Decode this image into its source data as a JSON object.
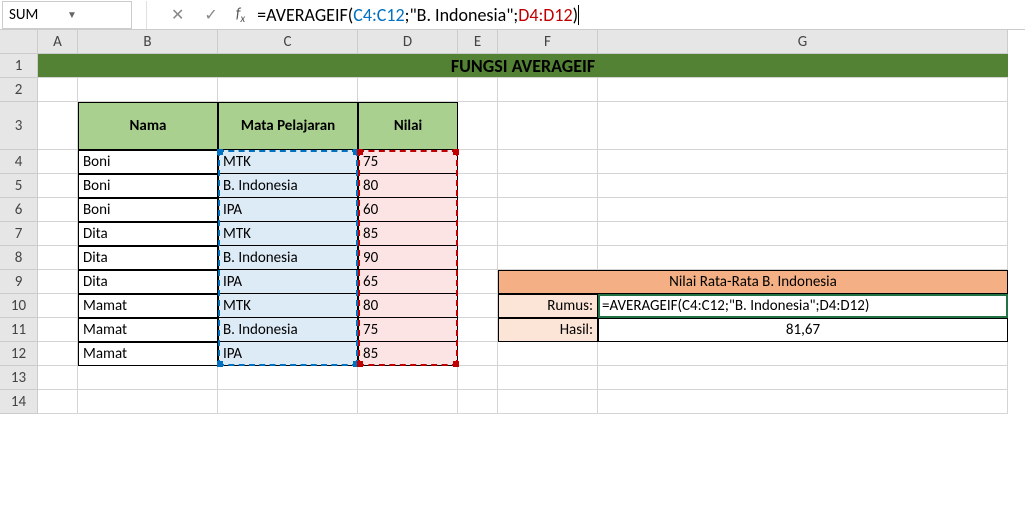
{
  "nameBox": "SUM",
  "formulaBar": {
    "prefix": "=AVERAGEIF(",
    "ref1": "C4:C12",
    "mid1": ";\"B. Indonesia\";",
    "ref2": "D4:D12",
    "suffix": ")"
  },
  "columns": [
    "A",
    "B",
    "C",
    "D",
    "E",
    "F",
    "G"
  ],
  "rows": [
    "1",
    "2",
    "3",
    "4",
    "5",
    "6",
    "7",
    "8",
    "9",
    "10",
    "11",
    "12",
    "13",
    "14"
  ],
  "title": "FUNGSI AVERAGEIF",
  "headers": {
    "nama": "Nama",
    "mapel": "Mata Pelajaran",
    "nilai": "Nilai"
  },
  "data": [
    {
      "nama": "Boni",
      "mapel": "MTK",
      "nilai": "75"
    },
    {
      "nama": "Boni",
      "mapel": "B. Indonesia",
      "nilai": "80"
    },
    {
      "nama": "Boni",
      "mapel": "IPA",
      "nilai": "60"
    },
    {
      "nama": "Dita",
      "mapel": "MTK",
      "nilai": "85"
    },
    {
      "nama": "Dita",
      "mapel": "B. Indonesia",
      "nilai": "90"
    },
    {
      "nama": "Dita",
      "mapel": "IPA",
      "nilai": "65"
    },
    {
      "nama": "Mamat",
      "mapel": "MTK",
      "nilai": "80"
    },
    {
      "nama": "Mamat",
      "mapel": "B. Indonesia",
      "nilai": "75"
    },
    {
      "nama": "Mamat",
      "mapel": "IPA",
      "nilai": "85"
    }
  ],
  "summary": {
    "title": "Nilai Rata-Rata B. Indonesia",
    "rumusLabel": "Rumus:",
    "rumusValue": "=AVERAGEIF(C4:C12;\"B. Indonesia\";D4:D12)",
    "hasilLabel": "Hasil:",
    "hasilValue": "81,67"
  }
}
